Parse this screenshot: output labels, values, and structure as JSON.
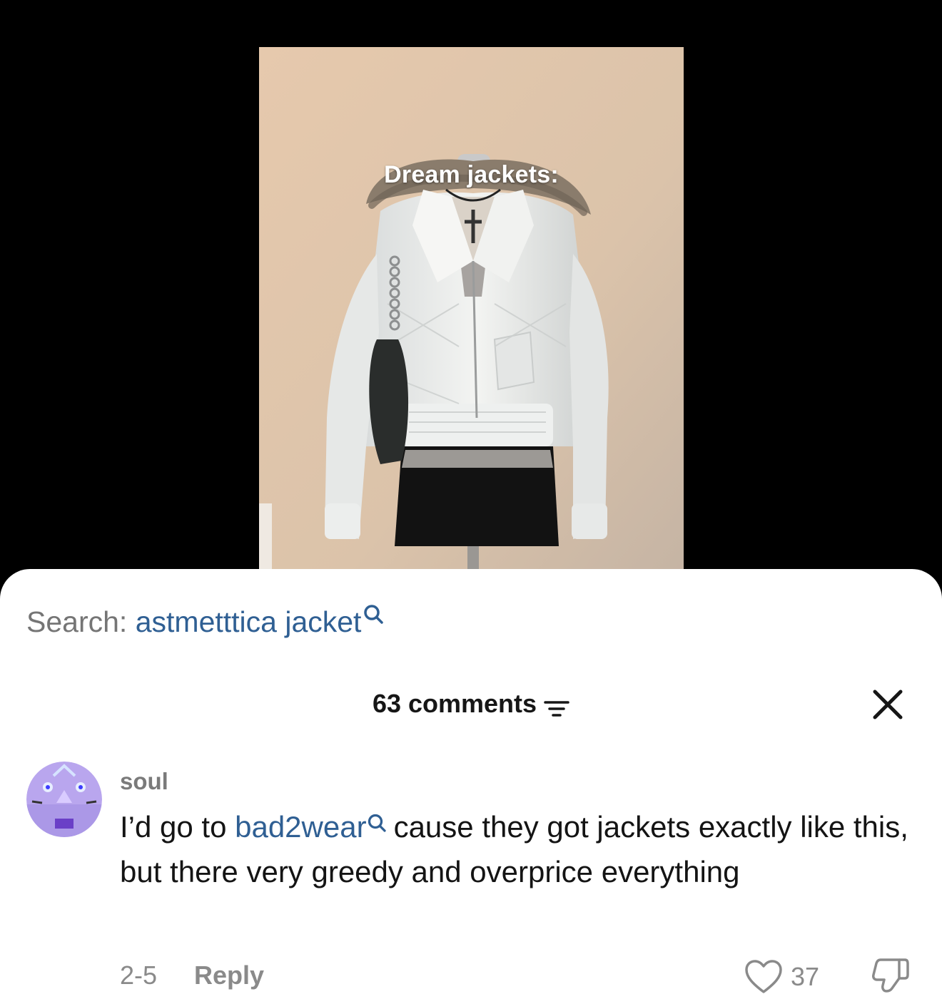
{
  "video": {
    "caption": "Dream jackets:"
  },
  "search": {
    "prefix": "Search:",
    "term": "astmetttica jacket"
  },
  "comments_header": {
    "count_label": "63 comments"
  },
  "comment": {
    "username": "soul",
    "text_before_mention": "I’d go to ",
    "mention": "bad2wear",
    "text_after_mention": "cause they got jackets exactly like this, but there very greedy and overprice everything",
    "date": "2-5",
    "reply_label": "Reply",
    "like_count": "37"
  },
  "colors": {
    "link_blue": "#2f5f93",
    "muted_gray": "#8a8a8a",
    "sheet_bg": "#ffffff",
    "background": "#000000"
  },
  "icons": {
    "search": "search-icon",
    "filter": "filter-icon",
    "close": "close-icon",
    "like": "heart-icon",
    "dislike": "thumbs-down-icon"
  }
}
